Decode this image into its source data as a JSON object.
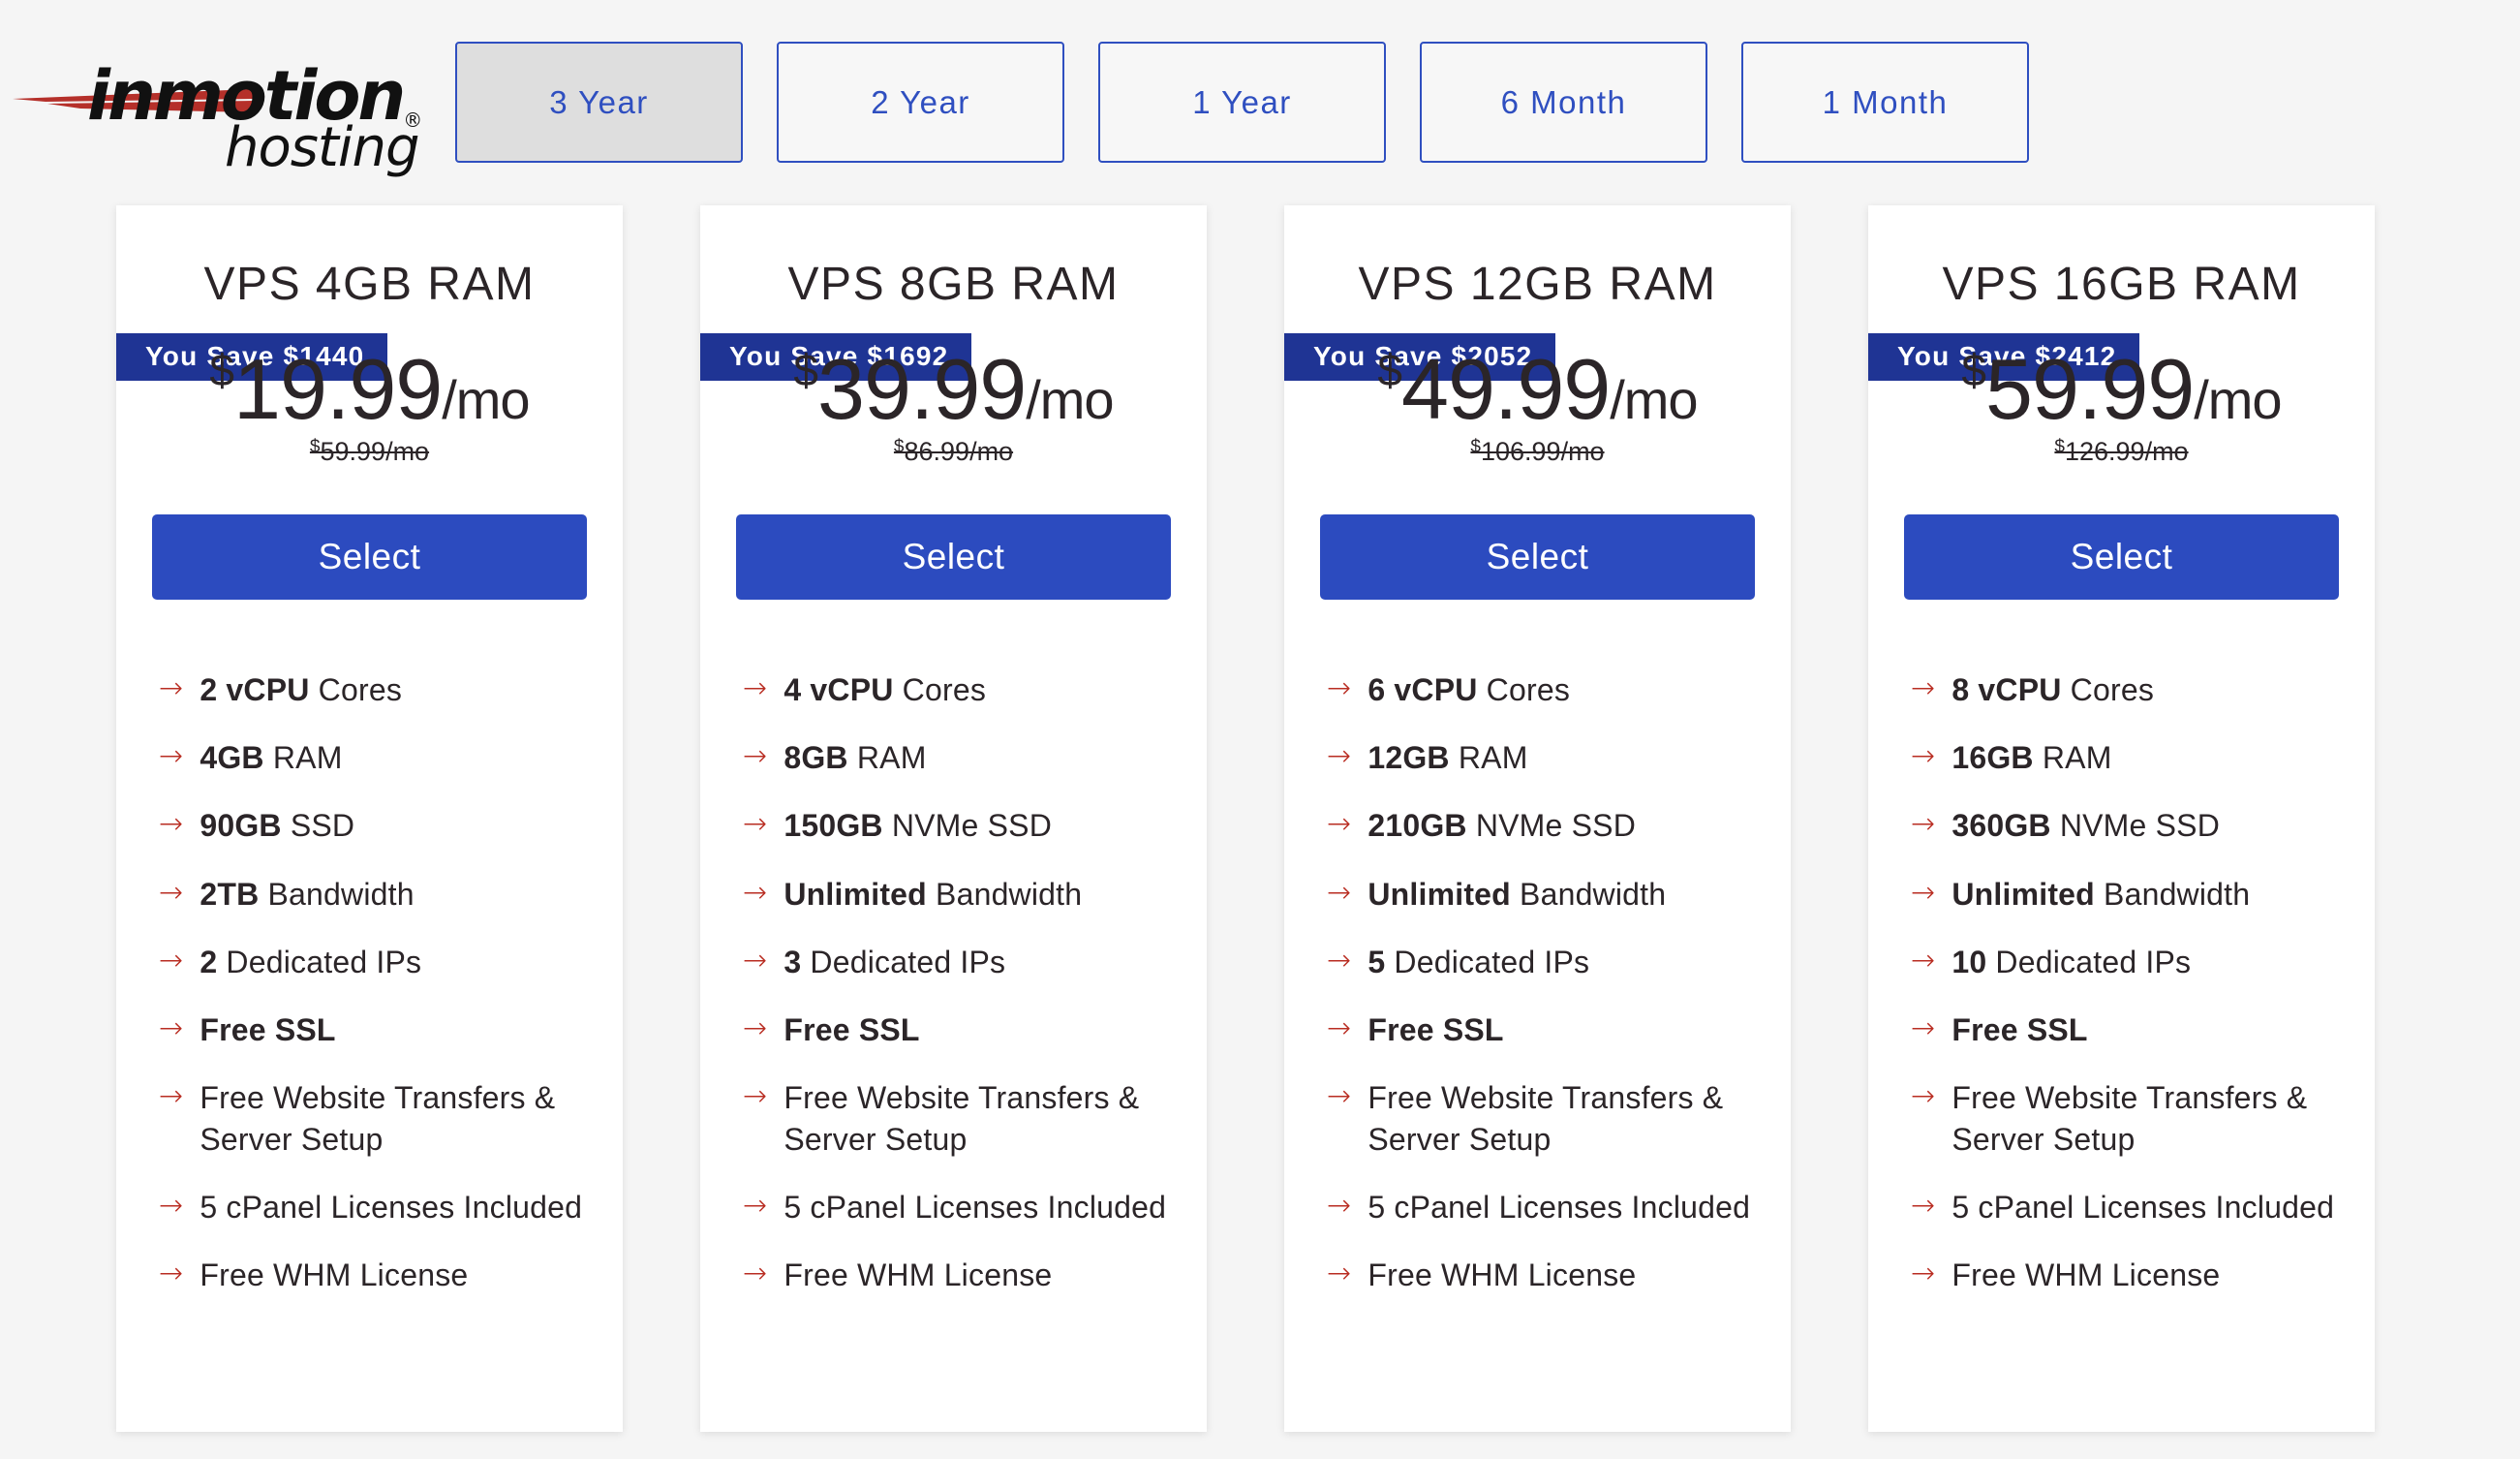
{
  "brand": {
    "logo_name": "inmotion",
    "logo_registered": "®",
    "logo_tagline": "hosting"
  },
  "term_selector": {
    "tabs": [
      {
        "label": "3 Year",
        "selected": true
      },
      {
        "label": "2 Year",
        "selected": false
      },
      {
        "label": "1 Year",
        "selected": false
      },
      {
        "label": "6 Month",
        "selected": false
      },
      {
        "label": "1 Month",
        "selected": false
      }
    ]
  },
  "colors": {
    "page_background": "#f5f5f5",
    "tab_border": "#2f4fc0",
    "tab_selected_background": "#dedede",
    "badge_background": "#1f3494",
    "select_button": "#2c4bbf",
    "arrow_red": "#b92d22",
    "text": "#2b2528"
  },
  "plans": [
    {
      "title": "VPS 4GB RAM",
      "savings_badge": "You Save $1440",
      "currency": "$",
      "price": "19.99",
      "period": "/mo",
      "old_price_currency": "$",
      "old_price": "59.99/mo",
      "select_label": "Select",
      "features": [
        {
          "bold": "2 vCPU",
          "rest": " Cores"
        },
        {
          "bold": "4GB",
          "rest": " RAM"
        },
        {
          "bold": "90GB",
          "rest": " SSD"
        },
        {
          "bold": "2TB",
          "rest": " Bandwidth"
        },
        {
          "bold": "2",
          "rest": " Dedicated IPs"
        },
        {
          "bold": "Free SSL",
          "rest": ""
        },
        {
          "bold": "",
          "rest": "Free Website Transfers & Server Setup"
        },
        {
          "bold": "",
          "rest": "5 cPanel Licenses Included"
        },
        {
          "bold": "",
          "rest": "Free WHM License"
        }
      ]
    },
    {
      "title": "VPS 8GB RAM",
      "savings_badge": "You Save $1692",
      "currency": "$",
      "price": "39.99",
      "period": "/mo",
      "old_price_currency": "$",
      "old_price": "86.99/mo",
      "select_label": "Select",
      "features": [
        {
          "bold": "4 vCPU",
          "rest": " Cores"
        },
        {
          "bold": "8GB",
          "rest": " RAM"
        },
        {
          "bold": "150GB",
          "rest": " NVMe SSD"
        },
        {
          "bold": "Unlimited",
          "rest": " Bandwidth"
        },
        {
          "bold": "3",
          "rest": " Dedicated IPs"
        },
        {
          "bold": "Free SSL",
          "rest": ""
        },
        {
          "bold": "",
          "rest": "Free Website Transfers & Server Setup"
        },
        {
          "bold": "",
          "rest": "5 cPanel Licenses Included"
        },
        {
          "bold": "",
          "rest": "Free WHM License"
        }
      ]
    },
    {
      "title": "VPS 12GB RAM",
      "savings_badge": "You Save $2052",
      "currency": "$",
      "price": "49.99",
      "period": "/mo",
      "old_price_currency": "$",
      "old_price": "106.99/mo",
      "select_label": "Select",
      "features": [
        {
          "bold": "6 vCPU",
          "rest": " Cores"
        },
        {
          "bold": "12GB",
          "rest": " RAM"
        },
        {
          "bold": "210GB",
          "rest": " NVMe SSD"
        },
        {
          "bold": "Unlimited",
          "rest": " Bandwidth"
        },
        {
          "bold": "5",
          "rest": " Dedicated IPs"
        },
        {
          "bold": "Free SSL",
          "rest": ""
        },
        {
          "bold": "",
          "rest": "Free Website Transfers & Server Setup"
        },
        {
          "bold": "",
          "rest": "5 cPanel Licenses Included"
        },
        {
          "bold": "",
          "rest": "Free WHM License"
        }
      ]
    },
    {
      "title": "VPS 16GB RAM",
      "savings_badge": "You Save $2412",
      "currency": "$",
      "price": "59.99",
      "period": "/mo",
      "old_price_currency": "$",
      "old_price": "126.99/mo",
      "select_label": "Select",
      "features": [
        {
          "bold": "8 vCPU",
          "rest": " Cores"
        },
        {
          "bold": "16GB",
          "rest": " RAM"
        },
        {
          "bold": "360GB",
          "rest": " NVMe SSD"
        },
        {
          "bold": "Unlimited",
          "rest": " Bandwidth"
        },
        {
          "bold": "10",
          "rest": " Dedicated IPs"
        },
        {
          "bold": "Free SSL",
          "rest": ""
        },
        {
          "bold": "",
          "rest": "Free Website Transfers & Server Setup"
        },
        {
          "bold": "",
          "rest": "5 cPanel Licenses Included"
        },
        {
          "bold": "",
          "rest": "Free WHM License"
        }
      ]
    }
  ],
  "icons": {
    "feature_arrow": "→"
  }
}
